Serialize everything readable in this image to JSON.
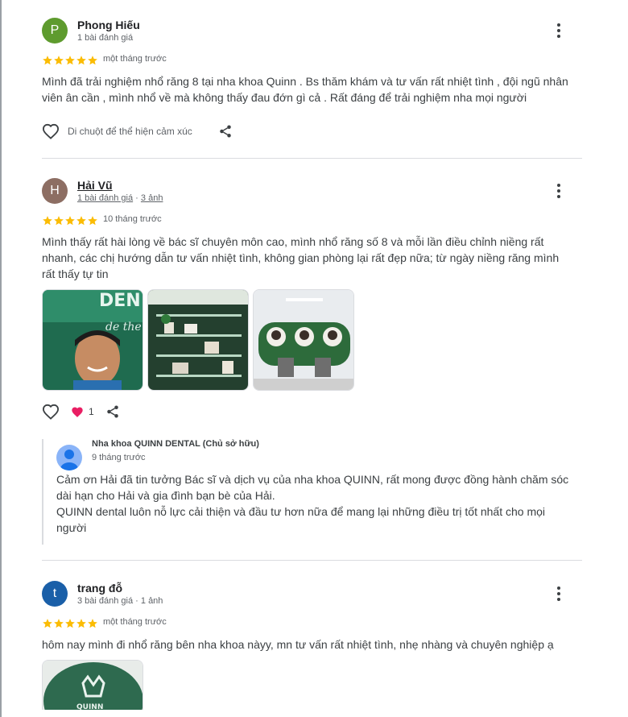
{
  "colors": {
    "star": "#fbbc04",
    "heart_filled": "#e91e63",
    "avatar_p": "#5e9b2e",
    "avatar_h": "#8d6e63",
    "avatar_t": "#1a5fa8",
    "owner_avatar": "#8ab4f8"
  },
  "reviews": [
    {
      "initial": "P",
      "name": "Phong Hiếu",
      "meta": "1 bài đánh giá",
      "rating": 5,
      "date": "một tháng trước",
      "text": "Mình đã trải nghiệm nhổ răng 8 tại nha khoa Quinn . Bs thăm khám và tư vấn rất nhiệt tình , đội ngũ nhân viên ân cần , mình nhổ về mà không thấy đau đớn gì cả . Rất đáng để trải nghiệm nha mọi người",
      "reaction_hint": "Di chuột để thể hiện cảm xúc"
    },
    {
      "initial": "H",
      "name": "Hải Vũ",
      "meta_reviews": "1 bài đánh giá",
      "meta_sep": " · ",
      "meta_photos": "3 ảnh",
      "rating": 5,
      "date": "10 tháng trước",
      "text": "Mình thấy rất hài lòng về bác sĩ chuyên môn cao, mình nhổ răng số 8 và mỗi lần điều chỉnh niềng rất nhanh, các chị hướng dẫn tư vấn nhiệt tình, không gian phòng lại rất đẹp nữa; từ ngày niềng răng mình rất thấy tự tin",
      "like_count": "1",
      "owner_reply": {
        "name": "Nha khoa QUINN DENTAL (Chủ sở hữu)",
        "date": "9 tháng trước",
        "line1": "Cảm ơn Hải đã tin tưởng Bác sĩ và dịch vụ của nha khoa QUINN, rất mong được đồng hành chăm sóc dài hạn cho Hải và gia đình bạn bè của Hải.",
        "line2": "QUINN dental luôn nỗ lực cải thiện và đầu tư hơn nữa để mang lại những điều trị tốt nhất cho mọi người"
      }
    },
    {
      "initial": "t",
      "name": "trang đỗ",
      "meta": "3 bài đánh giá · 1 ảnh",
      "rating": 5,
      "date": "một tháng trước",
      "text": "hôm nay mình đi nhổ răng bên nha khoa nàyy, mn tư vấn rất nhiệt tình, nhẹ nhàng và chuyên nghiệp ạ"
    }
  ]
}
